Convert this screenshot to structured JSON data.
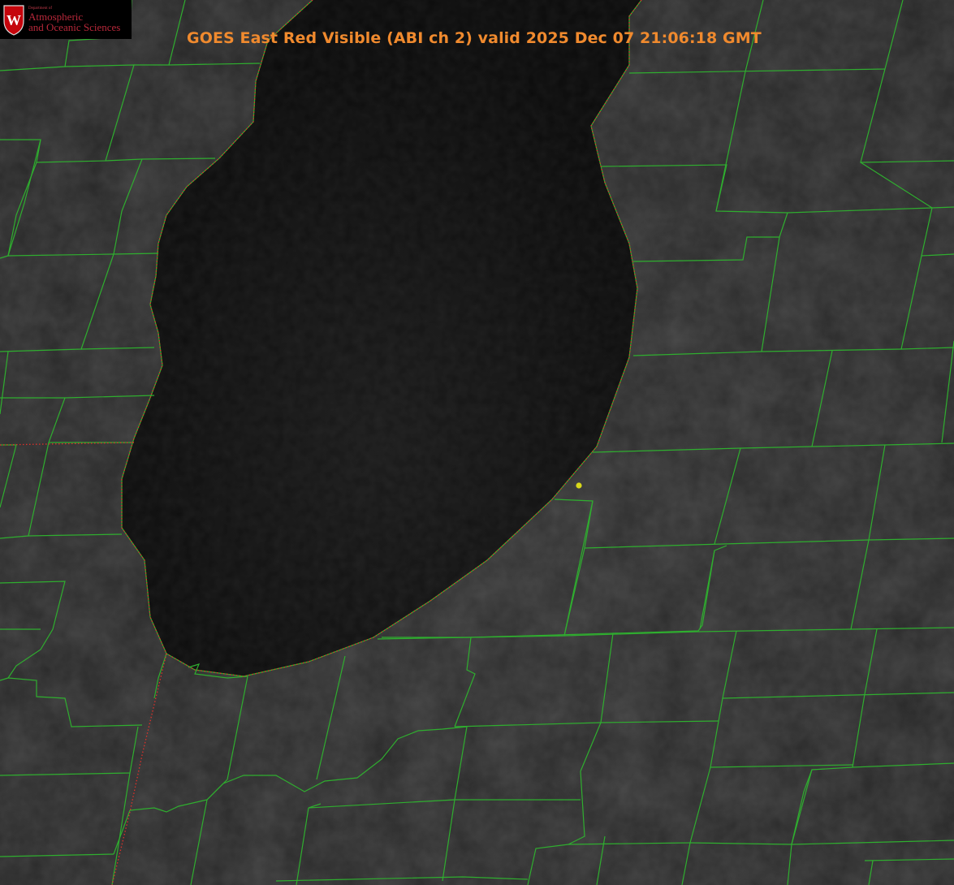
{
  "title": "GOES East Red Visible (ABI ch 2) valid 2025 Dec 07 21:06:18 GMT",
  "logo": {
    "department_line": "Department of",
    "line1": "Atmospheric",
    "line2": "and Oceanic Sciences",
    "shield_letter": "W"
  },
  "colors": {
    "title": "#f08a2e",
    "county_lines": "#2fae2f",
    "state_line": "#e0302a",
    "marker": "#d8d81a",
    "lake": "#0f0f0f",
    "land": "#262626"
  },
  "icons": {
    "marker": "yellow-dot-icon",
    "logo": "uw-shield-icon"
  }
}
